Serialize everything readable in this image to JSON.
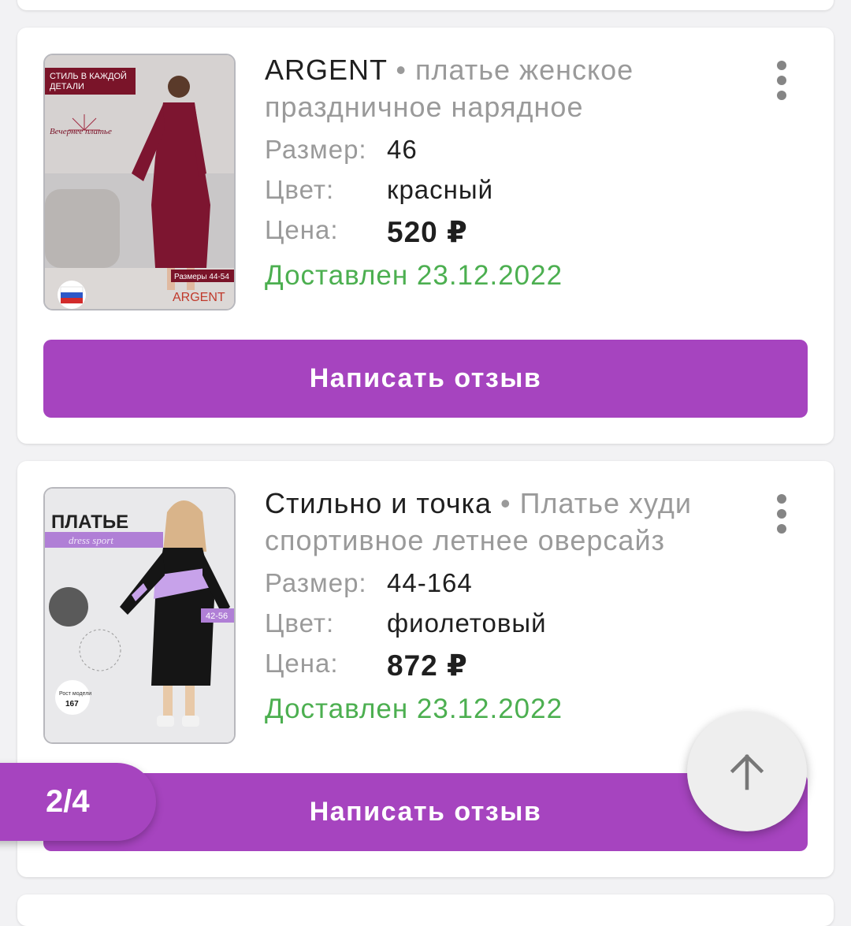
{
  "orders": [
    {
      "brand": "ARGENT",
      "separator": "•",
      "name": "платье женское праздничное нарядное",
      "size_label": "Размер:",
      "size": "46",
      "color_label": "Цвет:",
      "color": "красный",
      "price_label": "Цена:",
      "price": "520 ₽",
      "status": "Доставлен 23.12.2022",
      "review_button": "Написать отзыв",
      "image": {
        "badge_text": "СТИЛЬ В КАЖДОЙ ДЕТАЛИ",
        "caption": "Вечернее платье",
        "sizes": "Размеры 44-54",
        "made_in": "СШИТО В РОССИИ",
        "logo": "ARGENT"
      }
    },
    {
      "brand": "Стильно и точка",
      "separator": "•",
      "name": "Платье худи спортивное летнее оверсайз",
      "size_label": "Размер:",
      "size": "44-164",
      "color_label": "Цвет:",
      "color": "фиолетовый",
      "price_label": "Цена:",
      "price": "872 ₽",
      "status": "Доставлен 23.12.2022",
      "review_button": "Написать отзыв",
      "image": {
        "headline": "ПЛАТЬЕ",
        "sub": "dress sport",
        "sizes": "42-56",
        "height_label": "Рост модели",
        "height": "167"
      }
    }
  ],
  "pager": {
    "text": "2/4"
  },
  "fab": {
    "icon": "arrow-up-icon"
  },
  "colors": {
    "accent": "#a644bf",
    "status": "#4caf50",
    "muted": "#9a9a9a"
  }
}
